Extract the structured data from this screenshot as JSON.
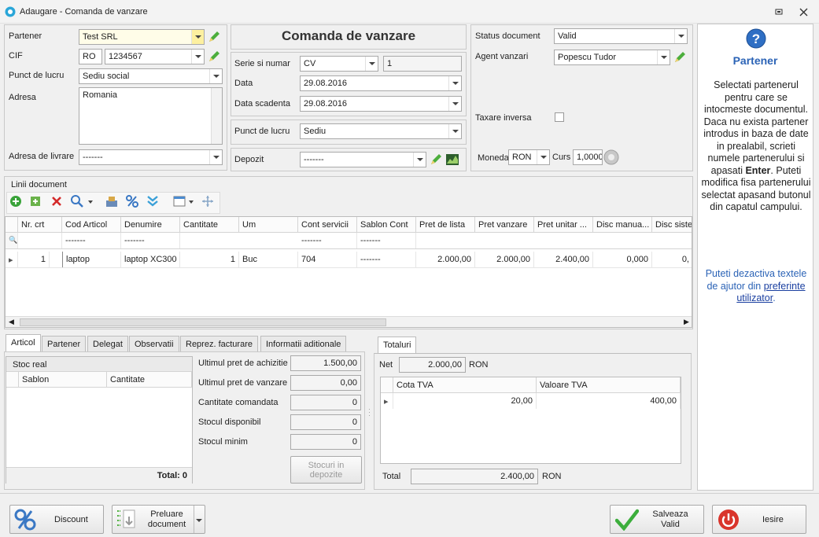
{
  "window": {
    "title": "Adaugare - Comanda de vanzare"
  },
  "partner_panel": {
    "partner_label": "Partener",
    "partner_value": "Test SRL",
    "cif_label": "CIF",
    "cif_prefix": "RO",
    "cif_value": "1234567",
    "work_point_label": "Punct de lucru",
    "work_point_value": "Sediu social",
    "address_label": "Adresa",
    "address_value": "Romania",
    "delivery_label": "Adresa de livrare",
    "delivery_value": "-------"
  },
  "doc_panel": {
    "heading": "Comanda de vanzare",
    "series_label": "Serie si numar",
    "series_value": "CV",
    "number_value": "1",
    "date_label": "Data",
    "date_value": "29.08.2016",
    "due_label": "Data scadenta",
    "due_value": "29.08.2016",
    "work_point_label": "Punct de lucru",
    "work_point_value": "Sediu",
    "deposit_label": "Depozit",
    "deposit_value": "-------"
  },
  "status_panel": {
    "status_label": "Status document",
    "status_value": "Valid",
    "agent_label": "Agent vanzari",
    "agent_value": "Popescu Tudor",
    "reverse_label": "Taxare inversa",
    "currency_label": "Moneda",
    "currency_value": "RON",
    "rate_label": "Curs",
    "rate_value": "1,0000"
  },
  "lines": {
    "title": "Linii document",
    "columns": [
      "Nr. crt",
      "Cod Articol",
      "Denumire",
      "Cantitate",
      "Um",
      "Cont servicii",
      "Sablon Cont",
      "Pret de lista",
      "Pret vanzare",
      "Pret unitar ...",
      "Disc manua...",
      "Disc sister"
    ],
    "filter": [
      "",
      "-------",
      "-------",
      "",
      "",
      "-------",
      "-------",
      "",
      "",
      "",
      "",
      ""
    ],
    "row": [
      "1",
      "laptop",
      "laptop  XC300",
      "1",
      "Buc",
      "704",
      "-------",
      "2.000,00",
      "2.000,00",
      "2.400,00",
      "0,000",
      "0,"
    ]
  },
  "bottom_tabs": [
    "Articol",
    "Partener",
    "Delegat",
    "Observatii",
    "Reprez. facturare",
    "Informatii aditionale"
  ],
  "stock": {
    "title": "Stoc real",
    "col1": "Sablon",
    "col2": "Cantitate",
    "total": "Total: 0",
    "last_buy_label": "Ultimul pret de achizitie",
    "last_buy_value": "1.500,00",
    "last_sell_label": "Ultimul pret de vanzare",
    "last_sell_value": "0,00",
    "ordered_label": "Cantitate comandata",
    "ordered_value": "0",
    "available_label": "Stocul disponibil",
    "available_value": "0",
    "min_label": "Stocul minim",
    "min_value": "0",
    "deposits_button": "Stocuri in depozite"
  },
  "totals": {
    "tab": "Totaluri",
    "net_label": "Net",
    "net_value": "2.000,00",
    "net_currency": "RON",
    "vat_col1": "Cota TVA",
    "vat_col2": "Valoare TVA",
    "vat_rate": "20,00",
    "vat_value": "400,00",
    "total_label": "Total",
    "total_value": "2.400,00",
    "total_currency": "RON"
  },
  "help": {
    "title": "Partener",
    "text_part1": "Selectati partenerul pentru care se intocmeste documentul. Daca nu exista partener introdus in baza de date in prealabil, scrieti numele partenerului si apasati ",
    "text_bold": "Enter",
    "text_part2": ". Puteti modifica fisa partenerului selectat apasand butonul din capatul campului.",
    "tip_text": "Puteti dezactiva textele de ajutor din ",
    "tip_link": "preferinte utilizator",
    "tip_end": "."
  },
  "footer": {
    "discount": "Discount",
    "import_doc": "Preluare document",
    "save": "Salveaza Valid",
    "exit": "Iesire"
  },
  "colors": {
    "accent": "#3a78c4",
    "save_green": "#3cae3c",
    "exit_red": "#d9342b",
    "help_blue": "#2b63b6"
  }
}
